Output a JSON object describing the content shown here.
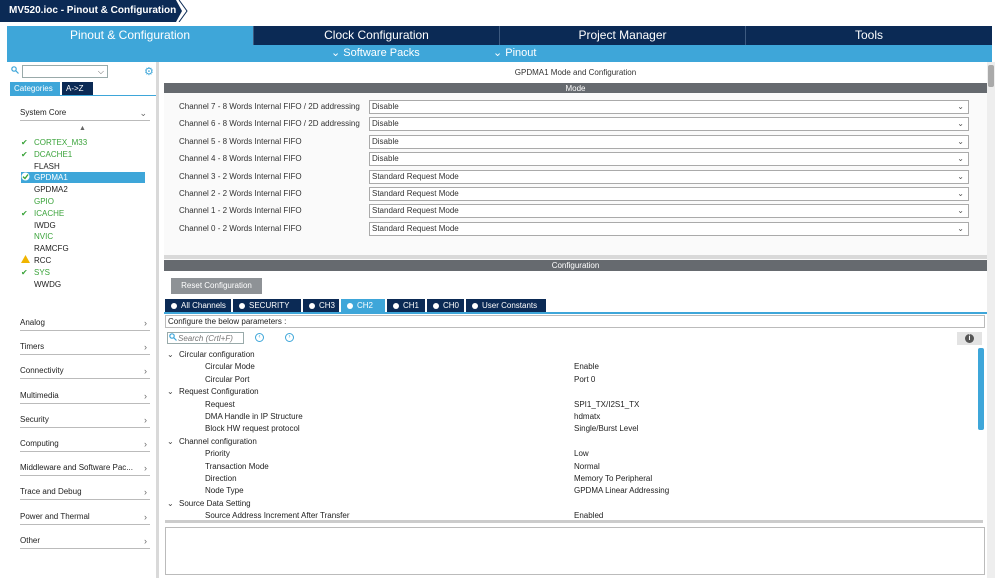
{
  "breadcrumb": {
    "file": "MV520.ioc - Pinout & Configuration"
  },
  "main_tabs": [
    "Pinout & Configuration",
    "Clock Configuration",
    "Project Manager",
    "Tools"
  ],
  "sub_menu": {
    "software_packs": "Software Packs",
    "pinout": "Pinout"
  },
  "left": {
    "category_tabs": [
      "Categories",
      "A->Z"
    ],
    "groups_top": "System Core",
    "peripherals": [
      {
        "name": "CORTEX_M33",
        "status": "ok"
      },
      {
        "name": "DCACHE1",
        "status": "ok"
      },
      {
        "name": "FLASH",
        "status": "none"
      },
      {
        "name": "GPDMA1",
        "status": "selected"
      },
      {
        "name": "GPDMA2",
        "status": "none"
      },
      {
        "name": "GPIO",
        "status": "green"
      },
      {
        "name": "ICACHE",
        "status": "ok"
      },
      {
        "name": "IWDG",
        "status": "none"
      },
      {
        "name": "NVIC",
        "status": "green"
      },
      {
        "name": "RAMCFG",
        "status": "none"
      },
      {
        "name": "RCC",
        "status": "warn"
      },
      {
        "name": "SYS",
        "status": "ok"
      },
      {
        "name": "WWDG",
        "status": "none"
      }
    ],
    "groups": [
      "Analog",
      "Timers",
      "Connectivity",
      "Multimedia",
      "Security",
      "Computing",
      "Middleware and Software Pac...",
      "Trace and Debug",
      "Power and Thermal",
      "Other"
    ]
  },
  "right": {
    "title": "GPDMA1 Mode and Configuration",
    "mode_header": "Mode",
    "channels": [
      {
        "label": "Channel 7  - 8 Words Internal FIFO / 2D addressing",
        "value": "Disable"
      },
      {
        "label": "Channel 6  - 8 Words Internal FIFO / 2D addressing",
        "value": "Disable"
      },
      {
        "label": "Channel 5  - 8 Words Internal FIFO",
        "value": "Disable"
      },
      {
        "label": "Channel 4  - 8 Words Internal FIFO",
        "value": "Disable"
      },
      {
        "label": "Channel 3  - 2 Words Internal FIFO",
        "value": "Standard Request Mode"
      },
      {
        "label": "Channel 2  - 2 Words Internal FIFO",
        "value": "Standard Request Mode"
      },
      {
        "label": "Channel 1  - 2 Words Internal FIFO",
        "value": "Standard Request Mode"
      },
      {
        "label": "Channel 0  - 2 Words Internal FIFO",
        "value": "Standard Request Mode"
      }
    ],
    "config_header": "Configuration",
    "reset_button": "Reset Configuration",
    "config_tabs": [
      "All Channels",
      "SECURITY",
      "CH3",
      "CH2",
      "CH1",
      "CH0",
      "User Constants"
    ],
    "params_label": "Configure the below parameters :",
    "search_placeholder": "Search (Crtl+F)",
    "tree": [
      {
        "type": "group",
        "name": "Circular configuration"
      },
      {
        "type": "item",
        "name": "Circular Mode",
        "value": "Enable"
      },
      {
        "type": "item",
        "name": "Circular Port",
        "value": "Port 0"
      },
      {
        "type": "group",
        "name": "Request Configuration"
      },
      {
        "type": "item",
        "name": "Request",
        "value": "SPI1_TX/I2S1_TX"
      },
      {
        "type": "item",
        "name": "DMA Handle in IP Structure",
        "value": "hdmatx"
      },
      {
        "type": "item",
        "name": "Block HW request protocol",
        "value": "Single/Burst Level"
      },
      {
        "type": "group",
        "name": "Channel configuration"
      },
      {
        "type": "item",
        "name": "Priority",
        "value": "Low"
      },
      {
        "type": "item",
        "name": "Transaction Mode",
        "value": "Normal"
      },
      {
        "type": "item",
        "name": "Direction",
        "value": "Memory To Peripheral"
      },
      {
        "type": "item",
        "name": "Node Type",
        "value": "GPDMA Linear Addressing"
      },
      {
        "type": "group",
        "name": "Source Data Setting"
      },
      {
        "type": "item",
        "name": "Source Address Increment After Transfer",
        "value": "Enabled"
      }
    ]
  },
  "colors": {
    "navy": "#0b2a55",
    "accent": "#3ea6d9",
    "ok": "#3aa33a",
    "warn": "#f0b400"
  }
}
